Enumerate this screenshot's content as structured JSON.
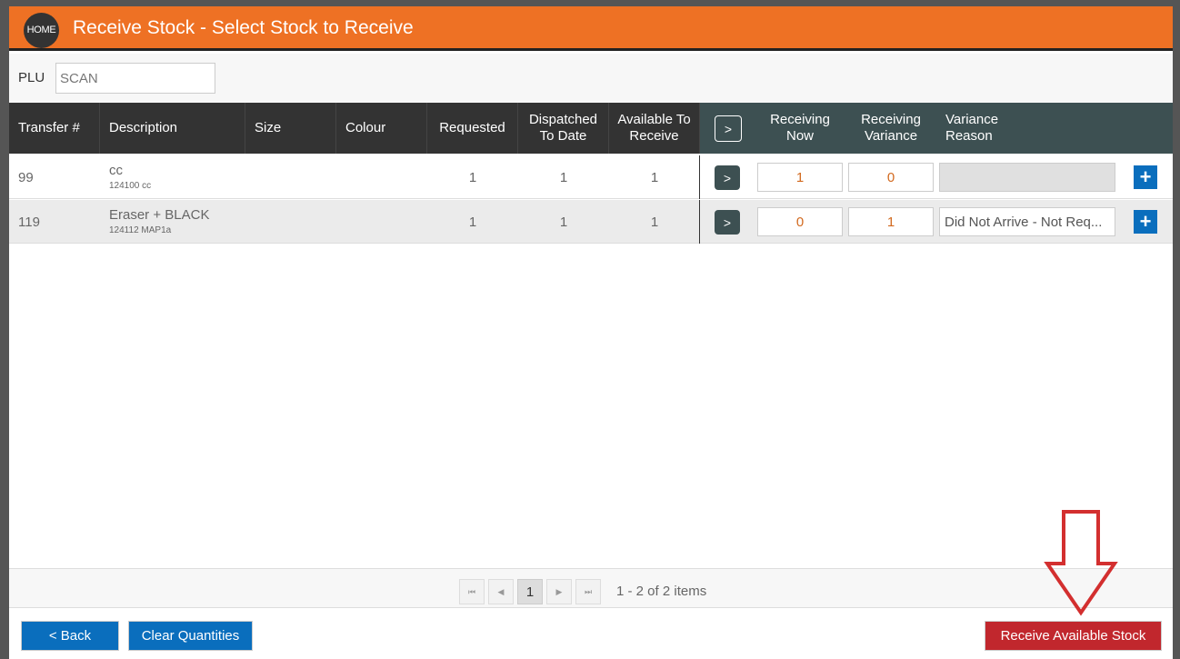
{
  "header": {
    "home_label": "HOME",
    "title": "Receive Stock - Select Stock to Receive"
  },
  "plu": {
    "label": "PLU",
    "placeholder": "SCAN"
  },
  "columns": {
    "transfer": "Transfer #",
    "description": "Description",
    "size": "Size",
    "colour": "Colour",
    "requested": "Requested",
    "dispatched": "Dispatched\nTo Date",
    "available": "Available To\nReceive",
    "toggle": ">",
    "receiving_now": "Receiving\nNow",
    "receiving_variance": "Receiving\nVariance",
    "variance_reason": "Variance\nReason"
  },
  "rows": [
    {
      "transfer": "99",
      "description": "cc",
      "sub": "124100  cc",
      "size": "",
      "colour": "",
      "requested": "1",
      "dispatched": "1",
      "available": "1",
      "toggle": ">",
      "receiving_now": "1",
      "receiving_variance": "0",
      "variance_reason": "",
      "add": "+"
    },
    {
      "transfer": "119",
      "description": "Eraser + BLACK",
      "sub": "124112  MAP1a",
      "size": "",
      "colour": "",
      "requested": "1",
      "dispatched": "1",
      "available": "1",
      "toggle": ">",
      "receiving_now": "0",
      "receiving_variance": "1",
      "variance_reason": "Did Not Arrive - Not Req...",
      "add": "+"
    }
  ],
  "pager": {
    "first": "⏮",
    "prev": "◀",
    "current": "1",
    "next": "▶",
    "last": "⏭",
    "info": "1 - 2 of 2 items"
  },
  "footer": {
    "back": "< Back",
    "clear": "Clear Quantities",
    "receive": "Receive Available Stock"
  },
  "colors": {
    "header": "#EE7124",
    "primary": "#0a6ebd",
    "danger": "#C1272D",
    "grid_head": "#333333",
    "grid_head_right": "#3d5052",
    "qty_text": "#D2691E"
  }
}
